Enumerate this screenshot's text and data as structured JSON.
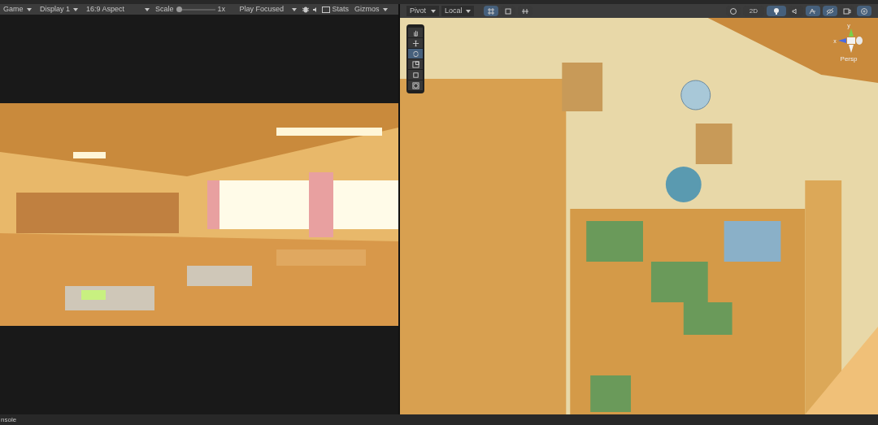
{
  "game_toolbar": {
    "view_menu": "Game",
    "display": "Display 1",
    "aspect": "16:9 Aspect",
    "scale": {
      "label": "Scale",
      "level": 0.0,
      "reading": "1x"
    },
    "play_mode": "Play Focused",
    "mute_on": false,
    "stats": "Stats",
    "gizmos": "Gizmos"
  },
  "scene_toolbar": {
    "pivot": "Pivot",
    "space": "Local",
    "toggle_2d": {
      "label": "2D",
      "on": false
    },
    "lighting_on": true
  },
  "scene_tools": [
    {
      "kind": "hand",
      "selected": false
    },
    {
      "kind": "move",
      "selected": false
    },
    {
      "kind": "rotate",
      "selected": true
    },
    {
      "kind": "scale",
      "selected": false
    },
    {
      "kind": "rect",
      "selected": false
    },
    {
      "kind": "transform",
      "selected": false
    }
  ],
  "orientation_gizmo": {
    "y": "y",
    "x": "x",
    "projection": "Persp"
  },
  "console_tab": "nsole"
}
